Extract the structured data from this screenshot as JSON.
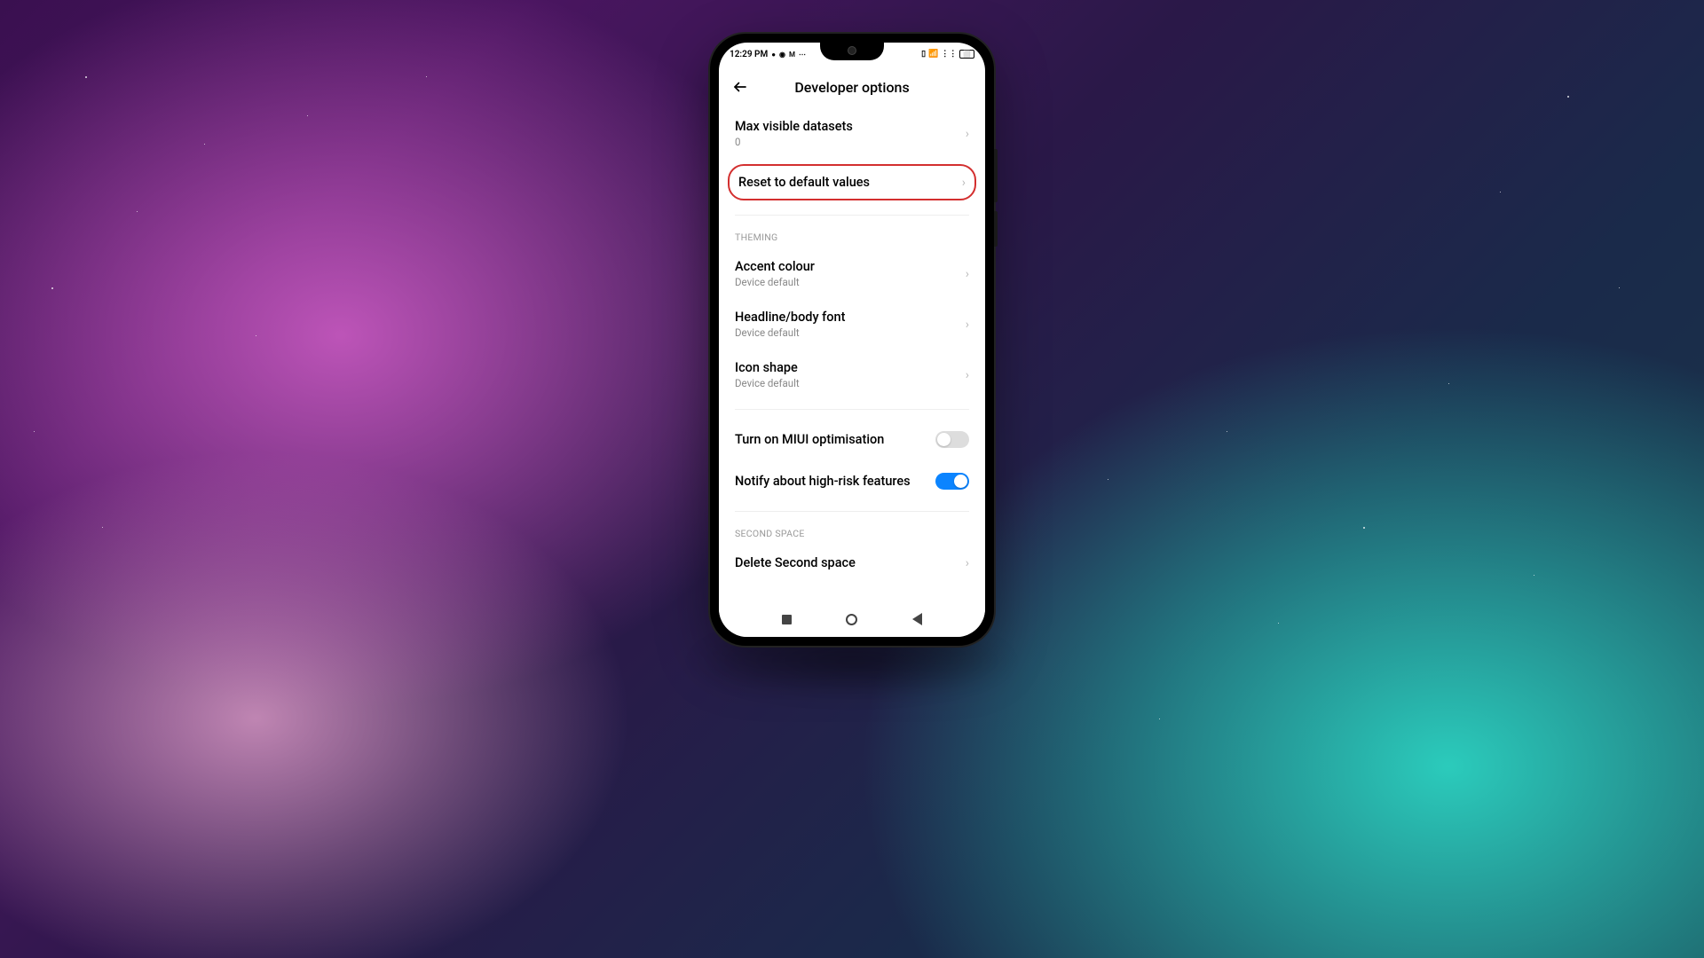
{
  "status": {
    "time": "12:29 PM",
    "icons_left": "● ⬤ M ⋯",
    "icons_right": "⬚ ◢ ⋮⋮"
  },
  "header": {
    "title": "Developer options"
  },
  "rows": {
    "max_datasets": {
      "title": "Max visible datasets",
      "sub": "0"
    },
    "reset": {
      "title": "Reset to default values"
    },
    "accent": {
      "title": "Accent colour",
      "sub": "Device default"
    },
    "headline": {
      "title": "Headline/body font",
      "sub": "Device default"
    },
    "iconshape": {
      "title": "Icon shape",
      "sub": "Device default"
    },
    "miui": {
      "title": "Turn on MIUI optimisation"
    },
    "notify": {
      "title": "Notify about high-risk features"
    },
    "delete_ss": {
      "title": "Delete Second space"
    }
  },
  "sections": {
    "theming": "THEMING",
    "second_space": "SECOND SPACE"
  }
}
